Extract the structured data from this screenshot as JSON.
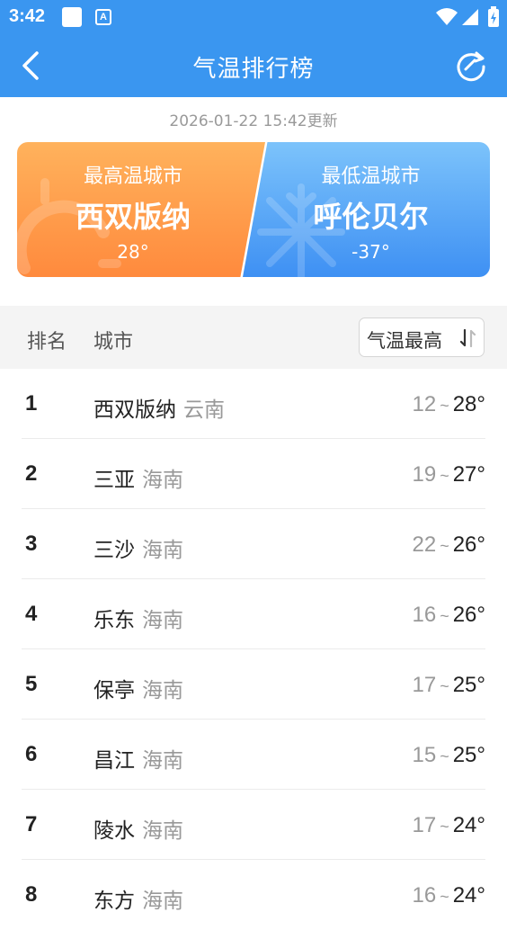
{
  "status_bar": {
    "time": "3:42",
    "app_badge": "A"
  },
  "header": {
    "title": "气温排行榜"
  },
  "update_time": "2026-01-22 15:42更新",
  "highest_card": {
    "label": "最高温城市",
    "city": "西双版纳",
    "temp": "28°"
  },
  "lowest_card": {
    "label": "最低温城市",
    "city": "呼伦贝尔",
    "temp": "-37°"
  },
  "table_header": {
    "rank": "排名",
    "city": "城市",
    "sort": "气温最高"
  },
  "rows": [
    {
      "rank": "1",
      "city": "西双版纳",
      "province": "云南",
      "low": "12",
      "high": "28°"
    },
    {
      "rank": "2",
      "city": "三亚",
      "province": "海南",
      "low": "19",
      "high": "27°"
    },
    {
      "rank": "3",
      "city": "三沙",
      "province": "海南",
      "low": "22",
      "high": "26°"
    },
    {
      "rank": "4",
      "city": "乐东",
      "province": "海南",
      "low": "16",
      "high": "26°"
    },
    {
      "rank": "5",
      "city": "保亭",
      "province": "海南",
      "low": "17",
      "high": "25°"
    },
    {
      "rank": "6",
      "city": "昌江",
      "province": "海南",
      "low": "15",
      "high": "25°"
    },
    {
      "rank": "7",
      "city": "陵水",
      "province": "海南",
      "low": "17",
      "high": "24°"
    },
    {
      "rank": "8",
      "city": "东方",
      "province": "海南",
      "low": "16",
      "high": "24°"
    }
  ],
  "tilde": "~",
  "colors": {
    "header_bg": "#3a96f0",
    "hot_card": "#ff8a3d",
    "cold_card": "#3e90f3"
  }
}
